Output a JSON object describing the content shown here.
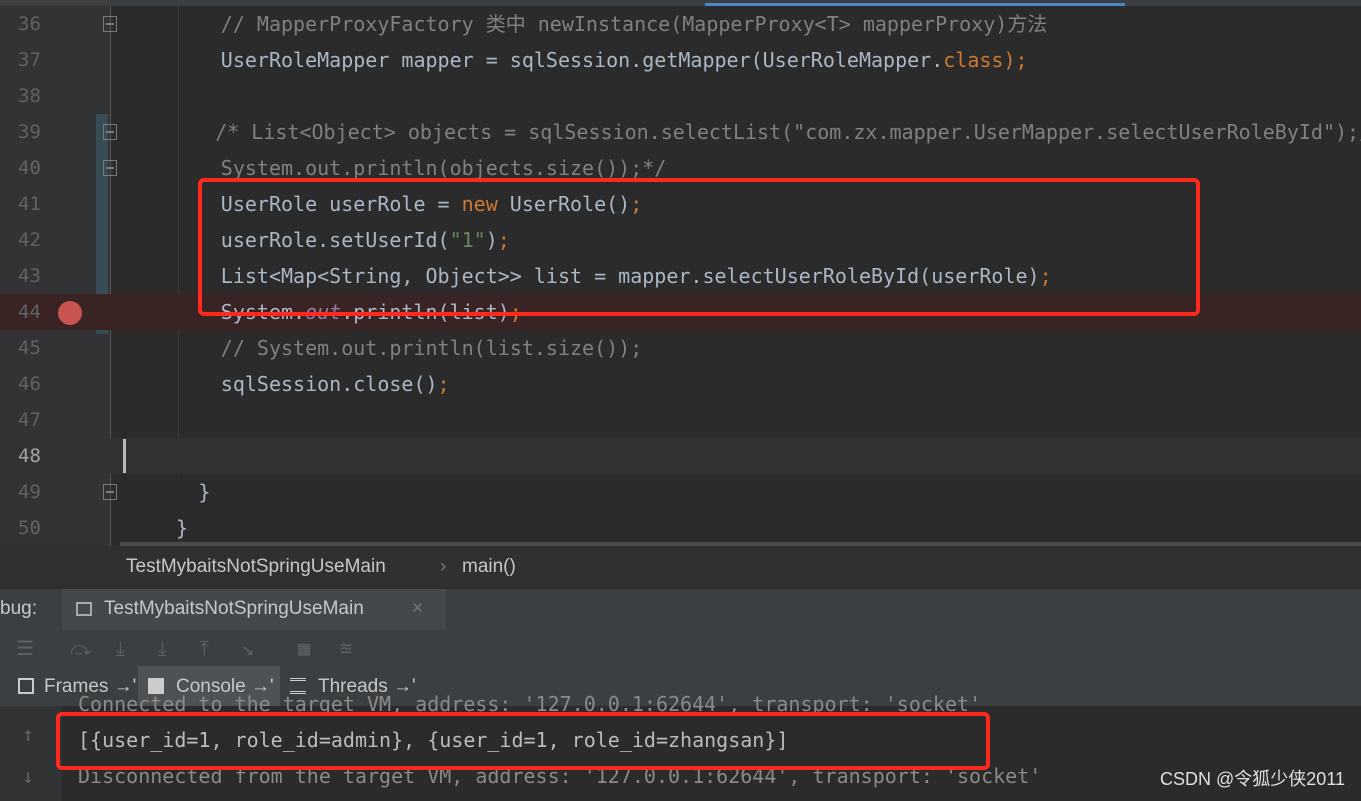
{
  "editor": {
    "lines": [
      {
        "num": "36",
        "indent": 18,
        "parts": [
          {
            "t": "// MapperProxyFactory 类中 newInstance(MapperProxy<T> mapperProxy)方法",
            "c": "cm"
          }
        ]
      },
      {
        "num": "37",
        "indent": 18,
        "parts": [
          {
            "t": "UserRoleMapper mapper = sqlSession.getMapper(UserRoleMapper.",
            "c": ""
          },
          {
            "t": "class",
            "c": "kw"
          },
          {
            "t": ");",
            "c": "kw"
          }
        ]
      },
      {
        "num": "38",
        "indent": 0,
        "parts": []
      },
      {
        "num": "39",
        "indent": 17,
        "parts": [
          {
            "t": "/* List<Object> objects = sqlSession.selectList(\"com.zx.mapper.UserMapper.selectUserRoleById\");/",
            "c": "cm"
          }
        ]
      },
      {
        "num": "40",
        "indent": 18,
        "parts": [
          {
            "t": "System.out.println(objects.size());*/",
            "c": "cm"
          }
        ]
      },
      {
        "num": "41",
        "indent": 18,
        "parts": [
          {
            "t": "UserRole userRole = ",
            "c": ""
          },
          {
            "t": "new",
            "c": "kw"
          },
          {
            "t": " UserRole()",
            "c": ""
          },
          {
            "t": ";",
            "c": "kw"
          }
        ]
      },
      {
        "num": "42",
        "indent": 18,
        "parts": [
          {
            "t": "userRole.setUserId(",
            "c": ""
          },
          {
            "t": "\"1\"",
            "c": "str"
          },
          {
            "t": ")",
            "c": ""
          },
          {
            "t": ";",
            "c": "kw"
          }
        ]
      },
      {
        "num": "43",
        "indent": 18,
        "parts": [
          {
            "t": "List<Map<String, Object>> list = mapper.selectUserRoleById(userRole)",
            "c": ""
          },
          {
            "t": ";",
            "c": "kw"
          }
        ]
      },
      {
        "num": "44",
        "indent": 18,
        "parts": [
          {
            "t": "System.",
            "c": ""
          },
          {
            "t": "out",
            "c": "fld"
          },
          {
            "t": ".println(list)",
            "c": ""
          },
          {
            "t": ";",
            "c": "kw"
          }
        ]
      },
      {
        "num": "45",
        "indent": 18,
        "parts": [
          {
            "t": "// System.out.println(list.size());",
            "c": "cm"
          }
        ]
      },
      {
        "num": "46",
        "indent": 18,
        "parts": [
          {
            "t": "sqlSession.close()",
            "c": ""
          },
          {
            "t": ";",
            "c": "kw"
          }
        ]
      },
      {
        "num": "47",
        "indent": 0,
        "parts": []
      },
      {
        "num": "48",
        "indent": 0,
        "parts": []
      },
      {
        "num": "49",
        "indent": 14,
        "parts": [
          {
            "t": "}",
            "c": ""
          }
        ]
      },
      {
        "num": "50",
        "indent": 10,
        "parts": [
          {
            "t": "}",
            "c": ""
          }
        ]
      }
    ],
    "current_line": "48",
    "breakpoint_line": "44"
  },
  "breadcrumb": {
    "class_name": "TestMybaitsNotSpringUseMain",
    "separator": "›",
    "method_name": "main()"
  },
  "debug": {
    "label": "bug:",
    "session_tab": "TestMybaitsNotSpringUseMain",
    "close_glyph": "×"
  },
  "toolbar": {
    "icons": [
      "list-icon",
      "step-over-icon",
      "step-into-icon",
      "force-step-into-icon",
      "step-out-icon",
      "run-to-cursor-icon",
      "evaluate-icon",
      "stream-icon"
    ]
  },
  "tabs": [
    {
      "label": "Frames →'",
      "icon": "frames-icon",
      "selected": false
    },
    {
      "label": "Console →'",
      "icon": "console-icon",
      "selected": true
    },
    {
      "label": "Threads →'",
      "icon": "threads-icon",
      "selected": false
    }
  ],
  "console": {
    "line_top": "Connected to the target VM, address: '127.0.0.1:62644', transport: 'socket'",
    "line_result": "[{user_id=1, role_id=admin}, {user_id=1, role_id=zhangsan}]",
    "line_bottom": "Disconnected from the target VM, address: '127.0.0.1:62644', transport: 'socket'"
  },
  "watermark": "CSDN @令狐少侠2011"
}
